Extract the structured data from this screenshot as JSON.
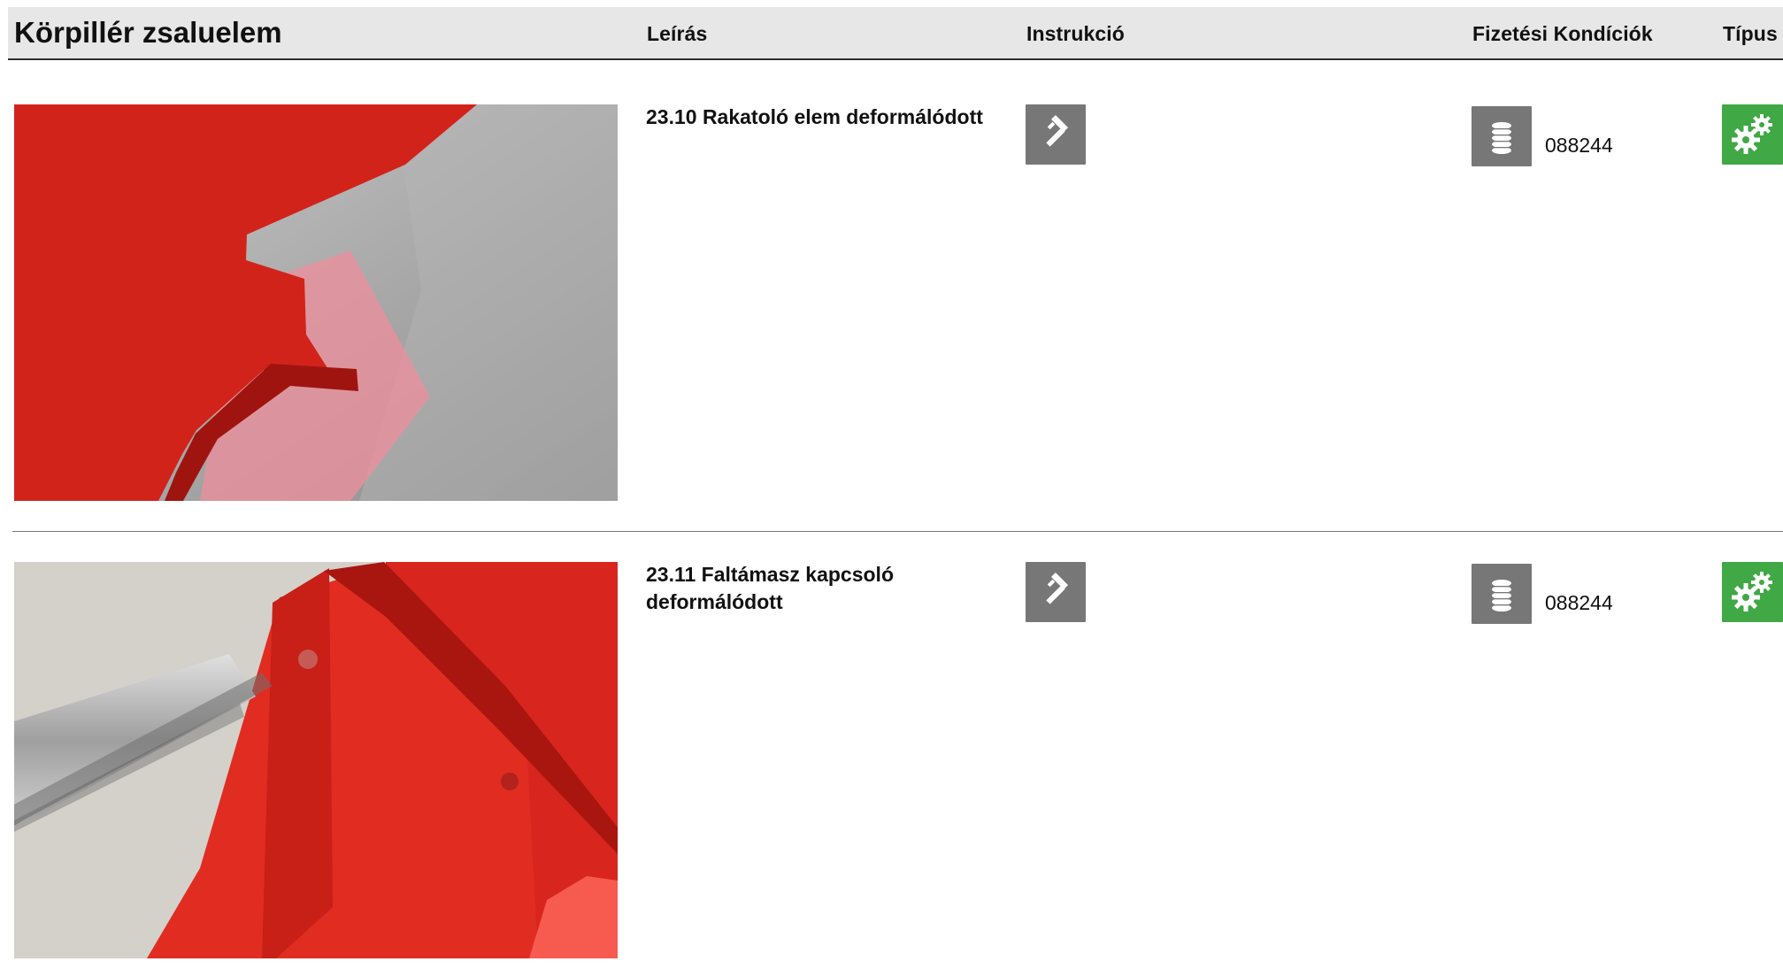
{
  "header": {
    "title": "Körpillér zsaluelem",
    "columns": {
      "description": "Leírás",
      "instruction": "Instrukció",
      "payment": "Fizetési Kondíciók",
      "type": "Típus"
    }
  },
  "rows": [
    {
      "title": "23.10 Rakatoló elem deformálódott",
      "code": "088244",
      "icons": {
        "instruction": "hammer-icon",
        "payment": "coin-stack-icon",
        "type": "gears-icon"
      }
    },
    {
      "title": "23.11 Faltámasz kapcsoló deformálódott",
      "code": "088244",
      "icons": {
        "instruction": "hammer-icon",
        "payment": "coin-stack-icon",
        "type": "gears-icon"
      }
    }
  ],
  "colors": {
    "header_background": "#e7e7e7",
    "icon_tile": "#777777",
    "type_tile": "#40a844",
    "product_red": "#d92c20"
  }
}
